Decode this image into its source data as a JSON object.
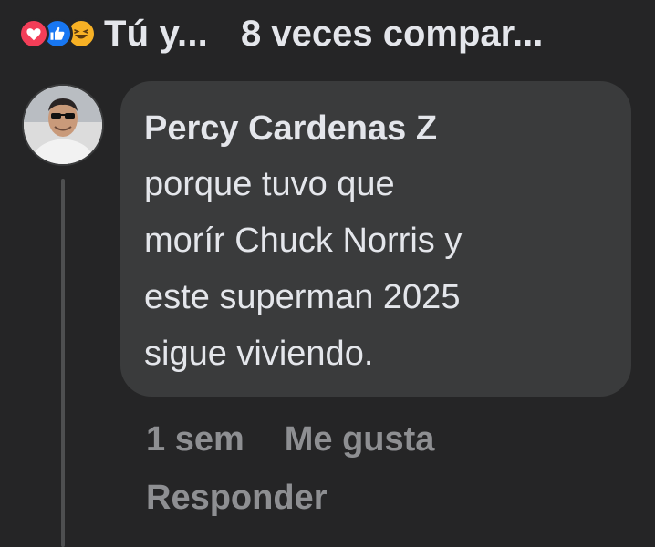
{
  "reactions": {
    "icons": [
      "love-icon",
      "like-icon",
      "haha-icon"
    ],
    "summary": "Tú y...",
    "shares": "8 veces compar..."
  },
  "comment": {
    "author": "Percy Cardenas Z",
    "text": "porque tuvo que\nmorír Chuck Norris y\neste superman 2025\nsigue viviendo.",
    "time": "1 sem",
    "like_label": "Me gusta",
    "reply_label": "Responder"
  },
  "colors": {
    "background": "#252526",
    "bubble": "#3a3b3c",
    "text": "#e4e6eb",
    "muted": "#8e8f92",
    "love": "#f33e58",
    "like": "#1877f2",
    "haha": "#f7b125"
  }
}
